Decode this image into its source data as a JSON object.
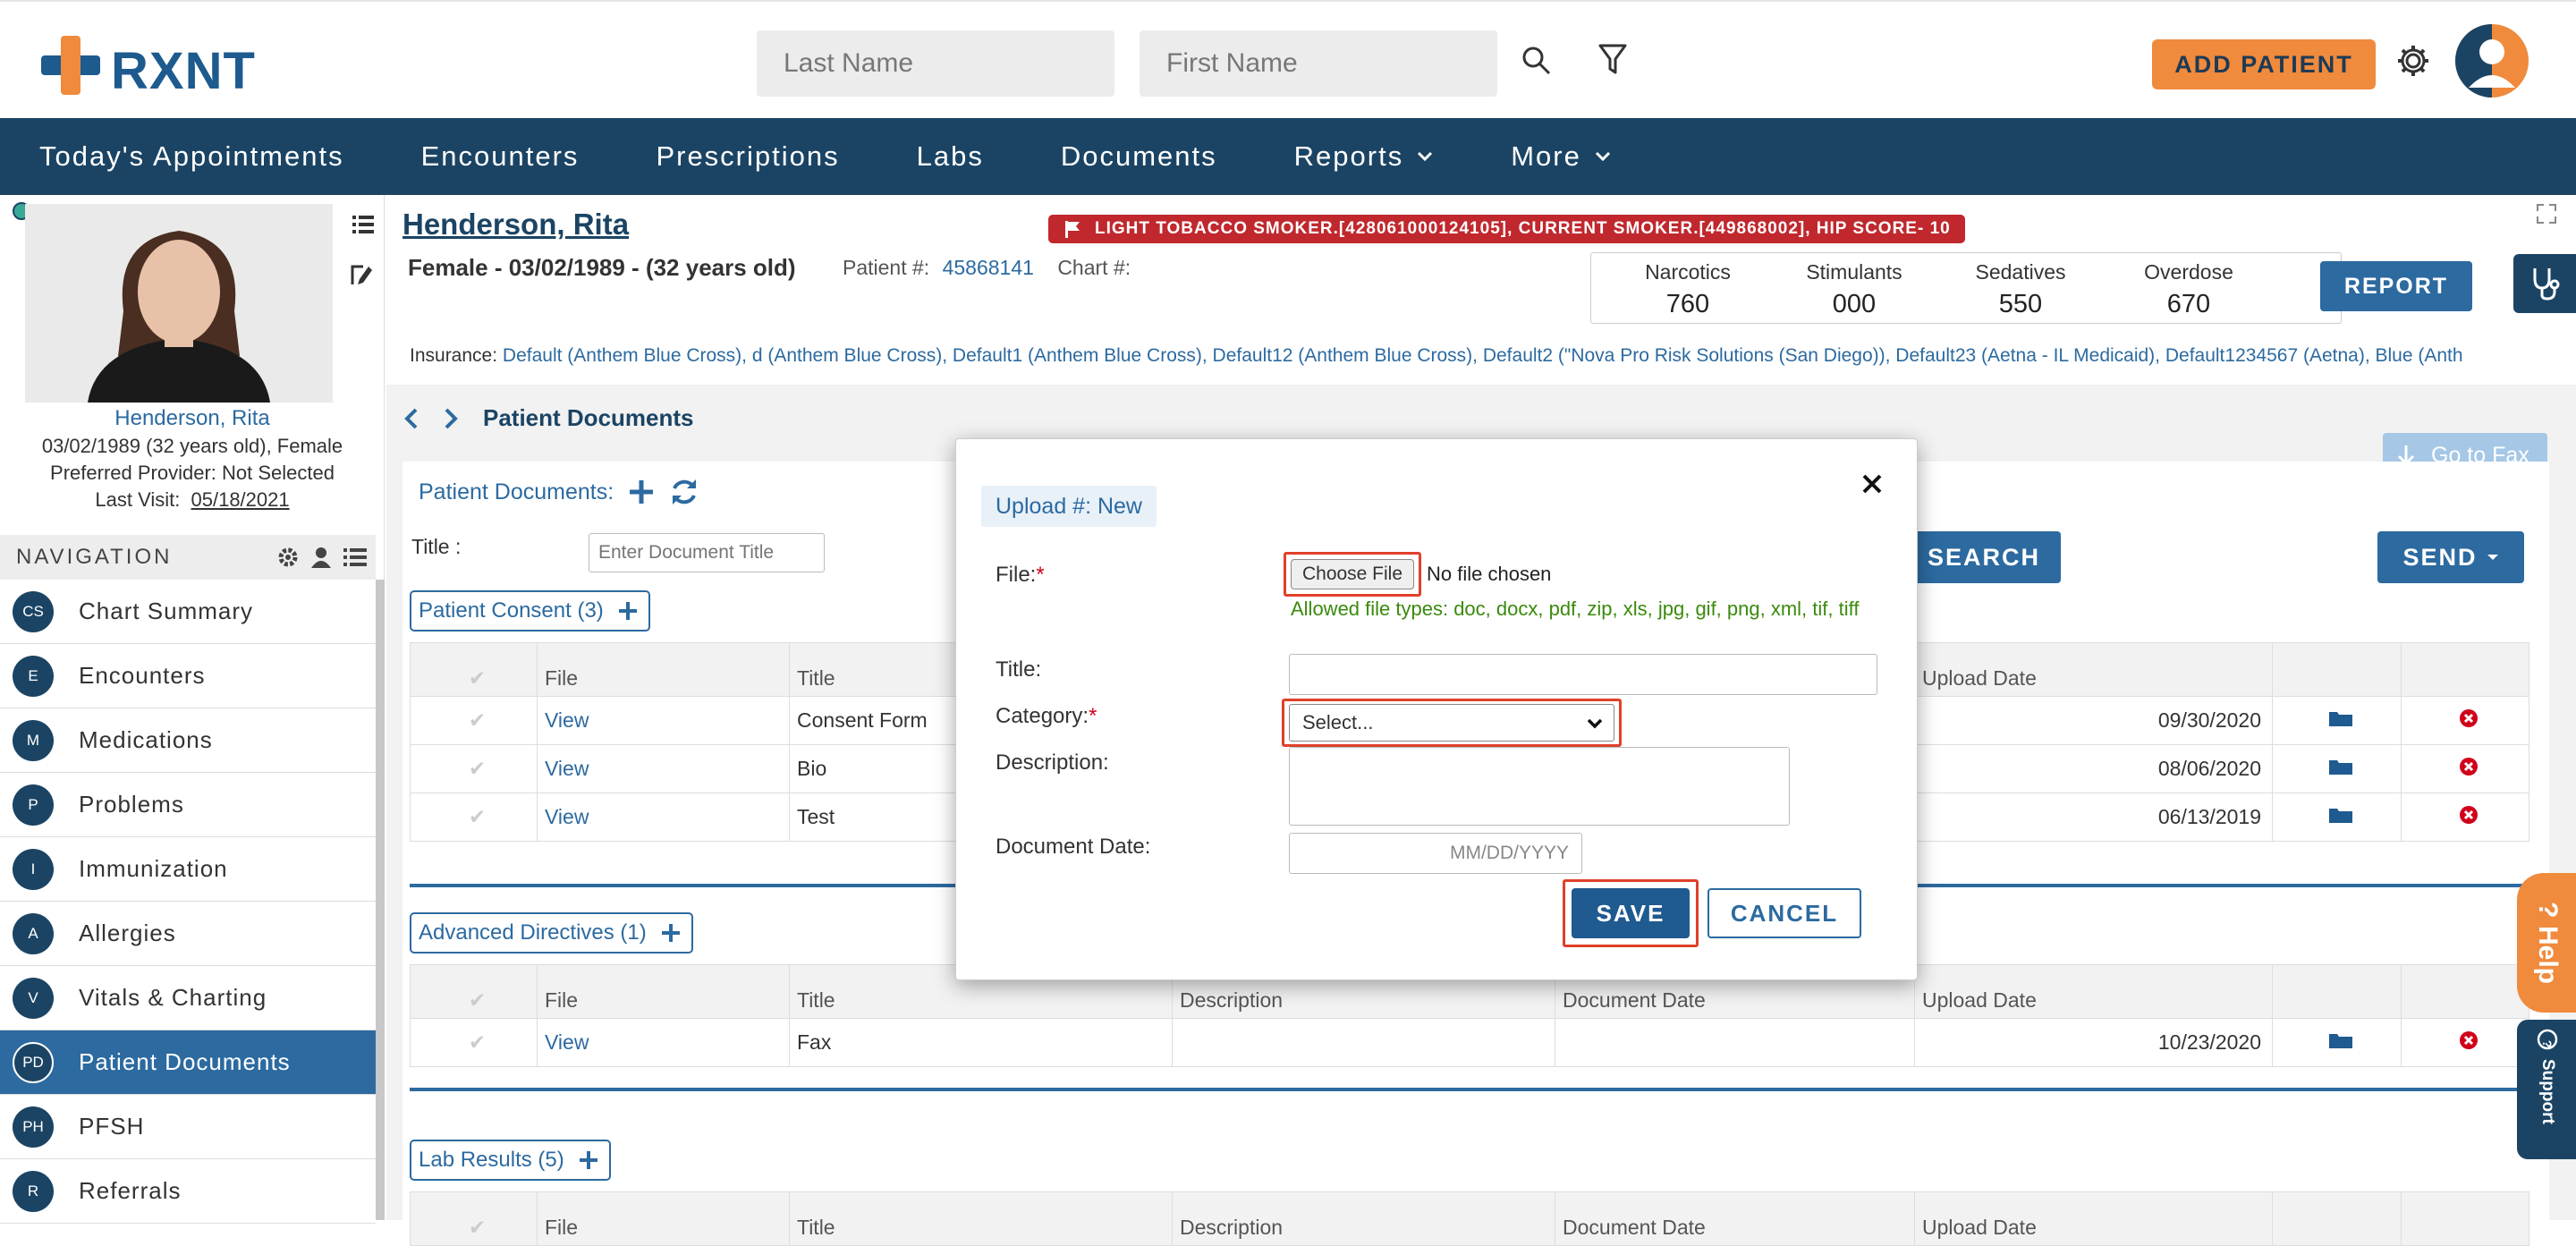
{
  "header": {
    "brand": "RXNT",
    "last_name_placeholder": "Last Name",
    "first_name_placeholder": "First Name",
    "add_patient": "ADD PATIENT"
  },
  "nav": {
    "items": [
      {
        "label": "Today's Appointments",
        "dropdown": false
      },
      {
        "label": "Encounters",
        "dropdown": false
      },
      {
        "label": "Prescriptions",
        "dropdown": false
      },
      {
        "label": "Labs",
        "dropdown": false
      },
      {
        "label": "Documents",
        "dropdown": false
      },
      {
        "label": "Reports",
        "dropdown": true
      },
      {
        "label": "More",
        "dropdown": true
      }
    ]
  },
  "patient": {
    "name": "Henderson, Rita",
    "name_link": "Henderson, Rita",
    "dob_line": "03/02/1989 (32 years old), Female",
    "provider_line": "Preferred Provider: Not Selected",
    "last_visit_label": "Last Visit:",
    "last_visit": "05/18/2021",
    "demographics": "Female - 03/02/1989 - (32 years old)",
    "patient_no_label": "Patient #:",
    "patient_no": "45868141",
    "chart_no_label": "Chart #:",
    "alert_tag": "LIGHT TOBACCO SMOKER.[428061000124105], CURRENT SMOKER.[449868002], HIP SCORE- 10",
    "insurance_label": "Insurance:",
    "insurance": "Default (Anthem Blue Cross), d (Anthem Blue Cross), Default1 (Anthem Blue Cross), Default12 (Anthem Blue Cross), Default2 (\"Nova Pro Risk Solutions (San Diego)), Default23 (Aetna - IL Medicaid), Default1234567 (Aetna), Blue (Anth"
  },
  "pdmp": {
    "stats": [
      {
        "label": "Narcotics",
        "value": "760"
      },
      {
        "label": "Stimulants",
        "value": "000"
      },
      {
        "label": "Sedatives",
        "value": "550"
      },
      {
        "label": "Overdose",
        "value": "670"
      }
    ],
    "report_btn": "REPORT"
  },
  "left_nav": {
    "header": "NAVIGATION",
    "items": [
      {
        "badge": "CS",
        "label": "Chart Summary",
        "active": false
      },
      {
        "badge": "E",
        "label": "Encounters",
        "active": false
      },
      {
        "badge": "M",
        "label": "Medications",
        "active": false
      },
      {
        "badge": "P",
        "label": "Problems",
        "active": false
      },
      {
        "badge": "I",
        "label": "Immunization",
        "active": false
      },
      {
        "badge": "A",
        "label": "Allergies",
        "active": false
      },
      {
        "badge": "V",
        "label": "Vitals & Charting",
        "active": false
      },
      {
        "badge": "PD",
        "label": "Patient Documents",
        "active": true
      },
      {
        "badge": "PH",
        "label": "PFSH",
        "active": false
      },
      {
        "badge": "R",
        "label": "Referrals",
        "active": false
      }
    ]
  },
  "documents": {
    "breadcrumb": "Patient Documents",
    "go_to_fax": "Go to Fax",
    "section_label": "Patient Documents:",
    "title_label": "Title :",
    "title_placeholder": "Enter Document Title",
    "search_btn": "SEARCH",
    "send_btn": "SEND",
    "columns": [
      "File",
      "Title",
      "Description",
      "Document Date",
      "Upload Date"
    ],
    "sections": [
      {
        "name": "Patient Consent (3)",
        "rows": [
          {
            "file": "View",
            "title": "Consent Form",
            "upload": "09/30/2020"
          },
          {
            "file": "View",
            "title": "Bio",
            "upload": "08/06/2020"
          },
          {
            "file": "View",
            "title": "Test",
            "upload": "06/13/2019"
          }
        ]
      },
      {
        "name": "Advanced Directives (1)",
        "rows": [
          {
            "file": "View",
            "title": "Fax",
            "upload": "10/23/2020"
          }
        ]
      },
      {
        "name": "Lab Results (5)",
        "rows": []
      }
    ]
  },
  "modal": {
    "title": "Upload #: New",
    "file_label": "File:",
    "choose_file": "Choose File",
    "no_file": "No file chosen",
    "allowed_types": "Allowed file types: doc, docx, pdf, zip, xls, jpg, gif, png, xml, tif, tiff",
    "title_label": "Title:",
    "category_label": "Category:",
    "category_value": "Select...",
    "description_label": "Description:",
    "doc_date_label": "Document Date:",
    "doc_date_placeholder": "MM/DD/YYYY",
    "save": "SAVE",
    "cancel": "CANCEL"
  },
  "side_tabs": {
    "help": "Help",
    "support": "Support"
  },
  "colors": {
    "nav_bg": "#1b4464",
    "accent_blue": "#2c6aa0",
    "orange": "#f08a3c",
    "alert_red": "#c0282e",
    "highlight": "#e0402a"
  }
}
